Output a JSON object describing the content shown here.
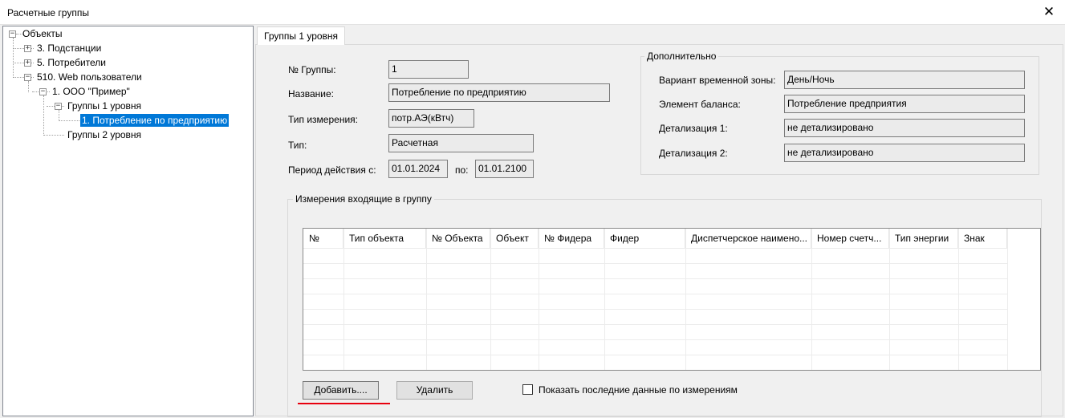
{
  "window": {
    "title": "Расчетные группы",
    "close_glyph": "✕"
  },
  "tree": {
    "root": "Объекты",
    "n1": "3. Подстанции",
    "n2": "5. Потребители",
    "n3": "510. Web пользователи",
    "n3_1": "1. ООО \"Пример\"",
    "n3_1_1": "Группы 1 уровня",
    "n3_1_1_1": "1. Потребление по предприятию",
    "n3_1_2": "Группы 2 уровня",
    "plus": "+",
    "minus": "−"
  },
  "tab": {
    "label": "Группы 1 уровня"
  },
  "form": {
    "group_no_label": "№ Группы:",
    "group_no": "1",
    "name_label": "Название:",
    "name": "Потребление по предприятию",
    "measure_type_label": "Тип измерения:",
    "measure_type": "потр.АЭ(кВтч)",
    "type_label": "Тип:",
    "type": "Расчетная",
    "period_label": "Период действия с:",
    "period_from": "01.01.2024",
    "period_to_label": "по:",
    "period_to": "01.01.2100"
  },
  "extra": {
    "legend": "Дополнительно",
    "timezone_label": "Вариант временной зоны:",
    "timezone": "День/Ночь",
    "balance_label": "Элемент баланса:",
    "balance": "Потребление предприятия",
    "detail1_label": "Детализация 1:",
    "detail1": "не детализировано",
    "detail2_label": "Детализация 2:",
    "detail2": "не детализировано"
  },
  "measurements": {
    "legend": "Измерения входящие в группу",
    "columns": [
      "№",
      "Тип объекта",
      "№ Объекта",
      "Объект",
      "№ Фидера",
      "Фидер",
      "Диспетчерское наимено...",
      "Номер счетч...",
      "Тип энергии",
      "Знак"
    ],
    "add_button": "Добавить....",
    "delete_button": "Удалить",
    "show_last_label": "Показать последние данные по измерениям",
    "show_last_checked": false
  },
  "colors": {
    "selection": "#0078d7",
    "annotation_underline": "#e8000e"
  }
}
